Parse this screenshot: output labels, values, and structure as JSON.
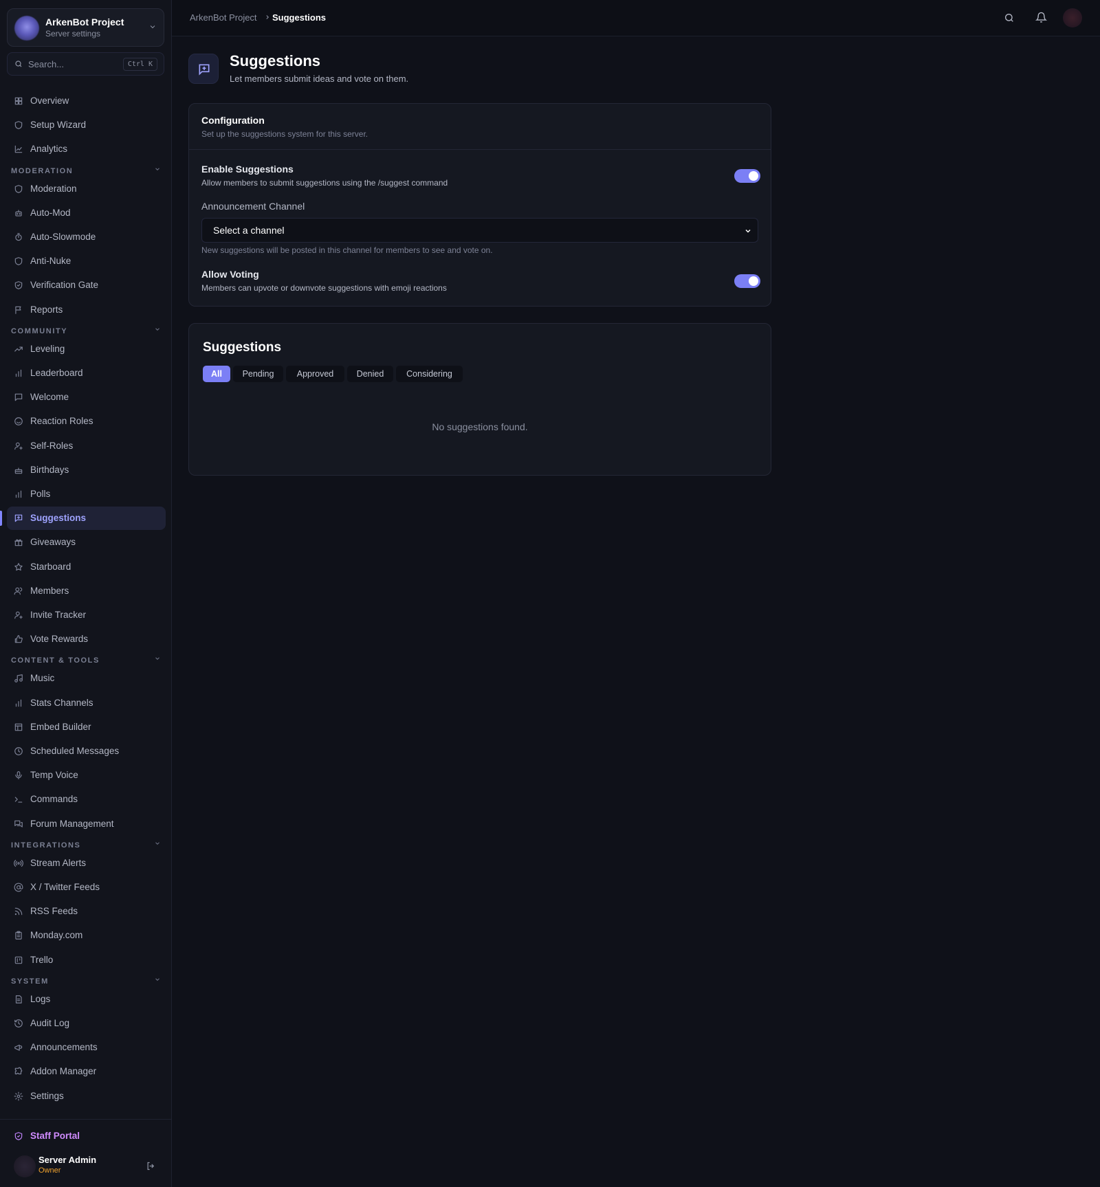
{
  "sidebar": {
    "server": {
      "name": "ArkenBot Project",
      "subtitle": "Server settings"
    },
    "search": {
      "placeholder": "Search...",
      "shortcut": "Ctrl K"
    },
    "top_items": [
      {
        "label": "Overview",
        "icon": "grid-icon"
      },
      {
        "label": "Setup Wizard",
        "icon": "shield-icon"
      },
      {
        "label": "Analytics",
        "icon": "chart-line-icon"
      }
    ],
    "sections": [
      {
        "title": "MODERATION",
        "items": [
          {
            "label": "Moderation",
            "icon": "shield-icon"
          },
          {
            "label": "Auto-Mod",
            "icon": "robot-icon"
          },
          {
            "label": "Auto-Slowmode",
            "icon": "timer-icon"
          },
          {
            "label": "Anti-Nuke",
            "icon": "shield-icon"
          },
          {
            "label": "Verification Gate",
            "icon": "shield-check-icon"
          },
          {
            "label": "Reports",
            "icon": "flag-icon"
          }
        ]
      },
      {
        "title": "COMMUNITY",
        "items": [
          {
            "label": "Leveling",
            "icon": "trending-up-icon"
          },
          {
            "label": "Leaderboard",
            "icon": "bar-chart-icon"
          },
          {
            "label": "Welcome",
            "icon": "message-icon"
          },
          {
            "label": "Reaction Roles",
            "icon": "smile-icon"
          },
          {
            "label": "Self-Roles",
            "icon": "user-plus-icon"
          },
          {
            "label": "Birthdays",
            "icon": "cake-icon"
          },
          {
            "label": "Polls",
            "icon": "bar-chart-icon"
          },
          {
            "label": "Suggestions",
            "icon": "message-plus-icon"
          },
          {
            "label": "Giveaways",
            "icon": "gift-icon"
          },
          {
            "label": "Starboard",
            "icon": "star-icon"
          },
          {
            "label": "Members",
            "icon": "users-icon"
          },
          {
            "label": "Invite Tracker",
            "icon": "user-plus-icon"
          },
          {
            "label": "Vote Rewards",
            "icon": "thumbs-up-icon"
          }
        ]
      },
      {
        "title": "CONTENT & TOOLS",
        "items": [
          {
            "label": "Music",
            "icon": "music-icon"
          },
          {
            "label": "Stats Channels",
            "icon": "bar-chart-icon"
          },
          {
            "label": "Embed Builder",
            "icon": "layout-icon"
          },
          {
            "label": "Scheduled Messages",
            "icon": "clock-icon"
          },
          {
            "label": "Temp Voice",
            "icon": "mic-icon"
          },
          {
            "label": "Commands",
            "icon": "terminal-icon"
          },
          {
            "label": "Forum Management",
            "icon": "messages-icon"
          }
        ]
      },
      {
        "title": "INTEGRATIONS",
        "items": [
          {
            "label": "Stream Alerts",
            "icon": "radio-icon"
          },
          {
            "label": "X / Twitter Feeds",
            "icon": "at-icon"
          },
          {
            "label": "RSS Feeds",
            "icon": "rss-icon"
          },
          {
            "label": "Monday.com",
            "icon": "clipboard-icon"
          },
          {
            "label": "Trello",
            "icon": "kanban-icon"
          }
        ]
      },
      {
        "title": "SYSTEM",
        "items": [
          {
            "label": "Logs",
            "icon": "file-text-icon"
          },
          {
            "label": "Audit Log",
            "icon": "history-icon"
          },
          {
            "label": "Announcements",
            "icon": "megaphone-icon"
          },
          {
            "label": "Addon Manager",
            "icon": "puzzle-icon"
          },
          {
            "label": "Settings",
            "icon": "gear-icon"
          }
        ]
      }
    ],
    "active_item": "Suggestions",
    "staff_portal": "Staff Portal",
    "user": {
      "name": "Server Admin",
      "role": "Owner"
    }
  },
  "topbar": {
    "breadcrumb_root": "ArkenBot Project",
    "breadcrumb_current": "Suggestions"
  },
  "page": {
    "title": "Suggestions",
    "description": "Let members submit ideas and vote on them."
  },
  "config": {
    "title": "Configuration",
    "subtitle": "Set up the suggestions system for this server.",
    "enable": {
      "title": "Enable Suggestions",
      "desc": "Allow members to submit suggestions using the /suggest command",
      "on": true
    },
    "channel": {
      "label": "Announcement Channel",
      "value": "Select a channel",
      "help": "New suggestions will be posted in this channel for members to see and vote on."
    },
    "voting": {
      "title": "Allow Voting",
      "desc": "Members can upvote or downvote suggestions with emoji reactions",
      "on": true
    }
  },
  "list": {
    "title": "Suggestions",
    "tabs": [
      "All",
      "Pending",
      "Approved",
      "Denied",
      "Considering"
    ],
    "active_tab": "All",
    "empty": "No suggestions found."
  },
  "colors": {
    "accent": "#7b7ff5",
    "accent_text": "#9fa3ff",
    "staff": "#d08cff",
    "owner": "#f0a22e"
  }
}
